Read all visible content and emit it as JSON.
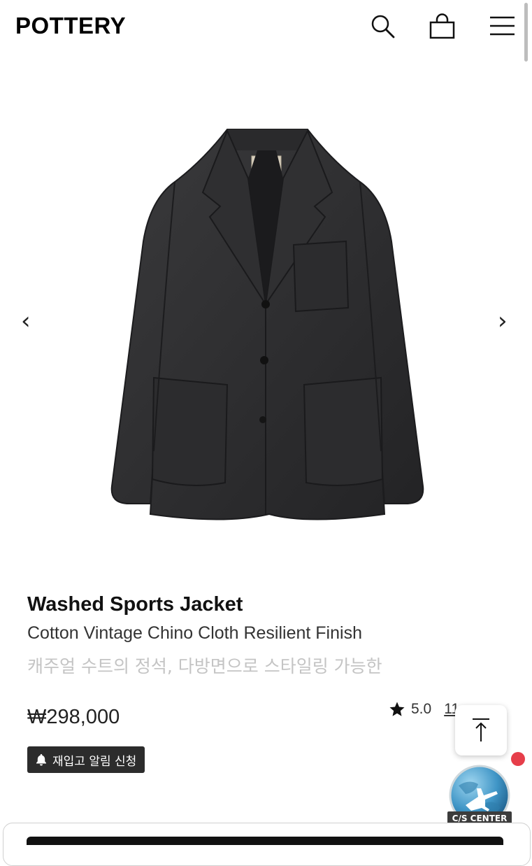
{
  "header": {
    "logo": "POTTERY",
    "icons": [
      "search-icon",
      "shopping-bag-icon",
      "hamburger-menu-icon"
    ]
  },
  "gallery": {
    "prev_arrow": "‹",
    "next_arrow": "›",
    "image": "washed-sports-jacket-photo",
    "jacket_color": "#2b2b2d"
  },
  "product": {
    "name": "Washed Sports Jacket",
    "subtitle": "Cotton Vintage Chino Cloth Resilient Finish",
    "description": "캐주얼 수트의 정석, 다방면으로 스타일링 가능한",
    "price": "₩298,000",
    "rating": "5.0",
    "review_count": "11"
  },
  "restock": {
    "label": "재입고 알림 신청",
    "icon": "bell-icon"
  },
  "floating": {
    "to_top_icon": "arrow-up-icon",
    "cs_label": "C/S CENTER",
    "notification_color": "#e63e4a"
  },
  "colors": {
    "text": "#111111",
    "muted": "#c4c4c4",
    "button_bg": "#2c2c2c"
  }
}
